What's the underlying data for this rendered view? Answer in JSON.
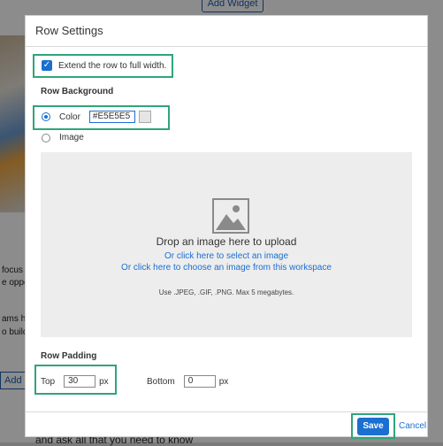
{
  "background": {
    "add_widget": "Add Widget",
    "text_lines": [
      "focus",
      "e oppo",
      "ams ha",
      "o build"
    ],
    "add_button": "Add",
    "bottom_text": "and ask all that you need to know"
  },
  "modal": {
    "title": "Row Settings",
    "full_width_label": "Extend the row to full width.",
    "full_width_checked": true,
    "row_background_title": "Row Background",
    "color_option_label": "Color",
    "color_value": "#E5E5E5",
    "image_option_label": "Image",
    "dropzone": {
      "main_text": "Drop an image here to upload",
      "link_select": "Or click here to select an image",
      "link_workspace": "Or click here to choose an image from this workspace",
      "note": "Use .JPEG, .GIF, .PNG. Max 5 megabytes."
    },
    "row_padding_title": "Row Padding",
    "top_label": "Top",
    "top_value": "30",
    "top_unit": "px",
    "bottom_label": "Bottom",
    "bottom_value": "0",
    "bottom_unit": "px",
    "save_label": "Save",
    "cancel_label": "Cancel"
  },
  "colors": {
    "accent": "#1a6fd1",
    "highlight": "#2fa57a",
    "swatch": "#E5E5E5"
  },
  "icons": {
    "checkbox": "check-icon",
    "dropzone": "image-placeholder-icon"
  }
}
